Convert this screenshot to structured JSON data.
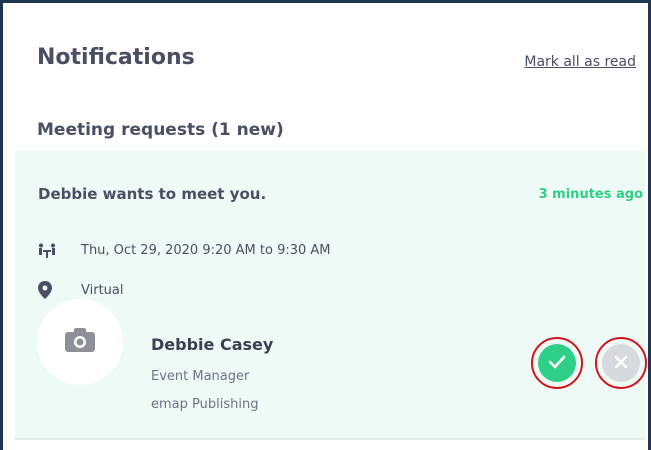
{
  "header": {
    "title": "Notifications",
    "mark_all_read": "Mark all as read"
  },
  "section": {
    "title": "Meeting requests (1 new)"
  },
  "request": {
    "message": "Debbie wants to meet you.",
    "time": "3 minutes ago",
    "datetime": "Thu, Oct 29, 2020 9:20 AM to 9:30 AM",
    "location": "Virtual",
    "person": {
      "name": "Debbie Casey",
      "role": "Event Manager",
      "company": "emap Publishing"
    }
  },
  "icons": {
    "meeting": "meeting-icon",
    "location": "location-pin-icon",
    "avatar": "camera-icon",
    "accept": "check-icon",
    "decline": "close-icon"
  },
  "colors": {
    "accent_green": "#2ecf86",
    "card_bg": "#eefaf6",
    "highlight_ring": "#d0161d",
    "decline_bg": "#d6d9de",
    "text": "#4b4f63"
  }
}
